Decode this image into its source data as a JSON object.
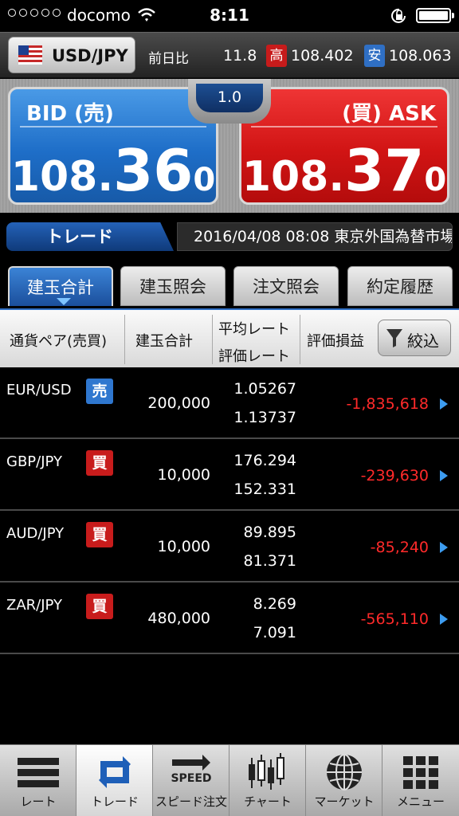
{
  "status": {
    "carrier": "docomo",
    "time": "8:11"
  },
  "header": {
    "pair": "USD/JPY",
    "prev_label": "前日比",
    "prev_value": "11.8",
    "high_badge": "高",
    "high_value": "108.402",
    "low_badge": "安",
    "low_value": "108.063"
  },
  "quote": {
    "spread": "1.0",
    "bid": {
      "label": "BID (売)",
      "main": "108.",
      "big": "36",
      "small": "0"
    },
    "ask": {
      "label": "(買) ASK",
      "main": "108.",
      "big": "37",
      "small": "0"
    }
  },
  "banner": {
    "title": "トレード",
    "news": "2016/04/08 08:08 東京外国為替市場"
  },
  "tabs": [
    {
      "label": "建玉合計",
      "active": true
    },
    {
      "label": "建玉照会"
    },
    {
      "label": "注文照会"
    },
    {
      "label": "約定履歴"
    }
  ],
  "table": {
    "headers": {
      "pair": "通貨ペア(売買)",
      "qty": "建玉合計",
      "avg": "平均レート",
      "eval": "評価レート",
      "pl": "評価損益",
      "filter": "絞込"
    },
    "rows": [
      {
        "pair": "EUR/USD",
        "side": "売",
        "qty": "200,000",
        "avg": "1.05267",
        "eval": "1.13737",
        "pl": "-1,835,618"
      },
      {
        "pair": "GBP/JPY",
        "side": "買",
        "qty": "10,000",
        "avg": "176.294",
        "eval": "152.331",
        "pl": "-239,630"
      },
      {
        "pair": "AUD/JPY",
        "side": "買",
        "qty": "10,000",
        "avg": "89.895",
        "eval": "81.371",
        "pl": "-85,240"
      },
      {
        "pair": "ZAR/JPY",
        "side": "買",
        "qty": "480,000",
        "avg": "8.269",
        "eval": "7.091",
        "pl": "-565,110"
      }
    ]
  },
  "nav": [
    {
      "label": "レート",
      "icon": "rate-icon"
    },
    {
      "label": "トレード",
      "icon": "trade-icon",
      "active": true
    },
    {
      "label": "スピード注文",
      "icon": "speed-icon",
      "icon_text": "SPEED"
    },
    {
      "label": "チャート",
      "icon": "chart-icon"
    },
    {
      "label": "マーケット",
      "icon": "globe-icon"
    },
    {
      "label": "メニュー",
      "icon": "menu-grid-icon"
    }
  ],
  "colors": {
    "bid": "#1e6ec8",
    "ask": "#d11414",
    "loss": "#ff2a2a",
    "accent": "#2f6fc4"
  }
}
